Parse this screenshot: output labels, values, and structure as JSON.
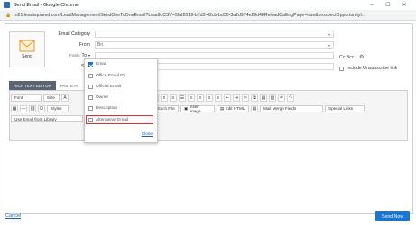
{
  "window": {
    "title": "Send Email - Google Chrome"
  },
  "address": {
    "url": "m21.leadsquared.com/LeadManagement/SendOneToOneEmail?LeadIdCSV=5faf2019-b7d3-42cb-bd30-3a2d974e29d48ReloadCallingPage=true&prospectOpportunityI..."
  },
  "send_panel": {
    "label": "Send"
  },
  "form": {
    "email_category_label": "Email Category",
    "from_label": "From",
    "from_value": "Bri",
    "to_label": "To",
    "fields_label": "Fields",
    "subject_label": "Sub",
    "cc_bcc": "Cc Bcc",
    "unsubscribe_label": "Include Unsubscribe link"
  },
  "editor": {
    "tabs": [
      "RICH TEXT EDITOR",
      "PASTE H"
    ],
    "font_label": "Font",
    "size_label": "Size",
    "styles_label": "Styles",
    "attach_label": "Attach File",
    "insert_image_label": "Insert Image",
    "edit_html_label": "Edit HTML",
    "mail_merge_label": "Mail Merge Fields",
    "special_links_label": "Special Links",
    "library_label": "Use Email from Library"
  },
  "to_dropdown": {
    "items": [
      {
        "label": "Email",
        "checked": true
      },
      {
        "label": "Office Email ID",
        "checked": false
      },
      {
        "label": "Official Email",
        "checked": false
      },
      {
        "label": "Owner",
        "checked": false
      },
      {
        "label": "Description",
        "checked": false
      },
      {
        "label": "Alternative Email",
        "checked": false
      }
    ],
    "close_label": "Close"
  },
  "footer": {
    "cancel_label": "Cancel",
    "send_now_label": "Send Now"
  },
  "colors": {
    "accent": "#1976d2",
    "highlight": "#d9333f"
  }
}
